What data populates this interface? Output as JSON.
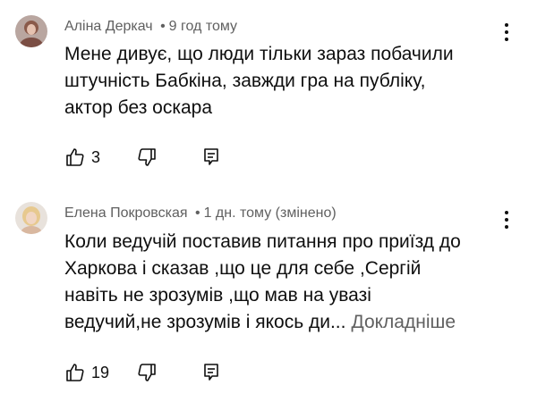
{
  "comments": [
    {
      "author": "Аліна Деркач",
      "separator": "•",
      "time": "9 год тому",
      "edited": "",
      "lines": [
        "Мене дивує, що люди тільки зараз побачили",
        "штучність Бабкіна, завжди гра на публіку,",
        "актор без оскара"
      ],
      "more": "",
      "likes": "3",
      "icons": {
        "like": "thumbs-up-icon",
        "dislike": "thumbs-down-icon",
        "reply": "reply-icon",
        "menu": "more-vertical-icon"
      }
    },
    {
      "author": "Елена Покровская",
      "separator": "•",
      "time": "1 дн. тому",
      "edited": "(змінено)",
      "lines": [
        "Коли ведучій поставив питання про приїзд до",
        "Харкова і сказав ,що це для себе ,Сергій",
        "навіть не зрозумів ,що мав на увазі",
        "ведучий,не зрозумів і якось ди..."
      ],
      "more": "Докладніше",
      "likes": "19",
      "icons": {
        "like": "thumbs-up-icon",
        "dislike": "thumbs-down-icon",
        "reply": "reply-icon",
        "menu": "more-vertical-icon"
      }
    }
  ],
  "colors": {
    "text": "#0f0f0f",
    "secondary": "#606060",
    "background": "#ffffff"
  }
}
